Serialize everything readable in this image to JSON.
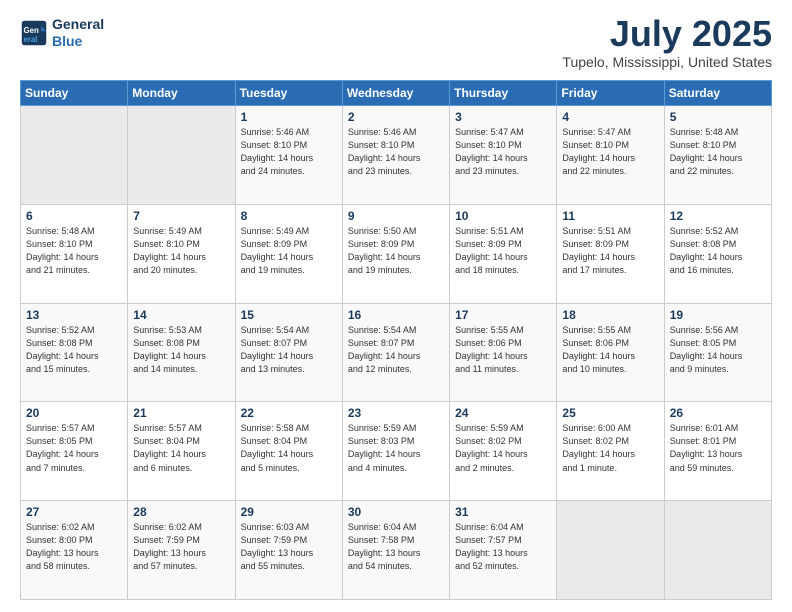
{
  "header": {
    "logo_line1": "General",
    "logo_line2": "Blue",
    "month": "July 2025",
    "location": "Tupelo, Mississippi, United States"
  },
  "days_of_week": [
    "Sunday",
    "Monday",
    "Tuesday",
    "Wednesday",
    "Thursday",
    "Friday",
    "Saturday"
  ],
  "weeks": [
    [
      {
        "day": "",
        "info": ""
      },
      {
        "day": "",
        "info": ""
      },
      {
        "day": "1",
        "info": "Sunrise: 5:46 AM\nSunset: 8:10 PM\nDaylight: 14 hours\nand 24 minutes."
      },
      {
        "day": "2",
        "info": "Sunrise: 5:46 AM\nSunset: 8:10 PM\nDaylight: 14 hours\nand 23 minutes."
      },
      {
        "day": "3",
        "info": "Sunrise: 5:47 AM\nSunset: 8:10 PM\nDaylight: 14 hours\nand 23 minutes."
      },
      {
        "day": "4",
        "info": "Sunrise: 5:47 AM\nSunset: 8:10 PM\nDaylight: 14 hours\nand 22 minutes."
      },
      {
        "day": "5",
        "info": "Sunrise: 5:48 AM\nSunset: 8:10 PM\nDaylight: 14 hours\nand 22 minutes."
      }
    ],
    [
      {
        "day": "6",
        "info": "Sunrise: 5:48 AM\nSunset: 8:10 PM\nDaylight: 14 hours\nand 21 minutes."
      },
      {
        "day": "7",
        "info": "Sunrise: 5:49 AM\nSunset: 8:10 PM\nDaylight: 14 hours\nand 20 minutes."
      },
      {
        "day": "8",
        "info": "Sunrise: 5:49 AM\nSunset: 8:09 PM\nDaylight: 14 hours\nand 19 minutes."
      },
      {
        "day": "9",
        "info": "Sunrise: 5:50 AM\nSunset: 8:09 PM\nDaylight: 14 hours\nand 19 minutes."
      },
      {
        "day": "10",
        "info": "Sunrise: 5:51 AM\nSunset: 8:09 PM\nDaylight: 14 hours\nand 18 minutes."
      },
      {
        "day": "11",
        "info": "Sunrise: 5:51 AM\nSunset: 8:09 PM\nDaylight: 14 hours\nand 17 minutes."
      },
      {
        "day": "12",
        "info": "Sunrise: 5:52 AM\nSunset: 8:08 PM\nDaylight: 14 hours\nand 16 minutes."
      }
    ],
    [
      {
        "day": "13",
        "info": "Sunrise: 5:52 AM\nSunset: 8:08 PM\nDaylight: 14 hours\nand 15 minutes."
      },
      {
        "day": "14",
        "info": "Sunrise: 5:53 AM\nSunset: 8:08 PM\nDaylight: 14 hours\nand 14 minutes."
      },
      {
        "day": "15",
        "info": "Sunrise: 5:54 AM\nSunset: 8:07 PM\nDaylight: 14 hours\nand 13 minutes."
      },
      {
        "day": "16",
        "info": "Sunrise: 5:54 AM\nSunset: 8:07 PM\nDaylight: 14 hours\nand 12 minutes."
      },
      {
        "day": "17",
        "info": "Sunrise: 5:55 AM\nSunset: 8:06 PM\nDaylight: 14 hours\nand 11 minutes."
      },
      {
        "day": "18",
        "info": "Sunrise: 5:55 AM\nSunset: 8:06 PM\nDaylight: 14 hours\nand 10 minutes."
      },
      {
        "day": "19",
        "info": "Sunrise: 5:56 AM\nSunset: 8:05 PM\nDaylight: 14 hours\nand 9 minutes."
      }
    ],
    [
      {
        "day": "20",
        "info": "Sunrise: 5:57 AM\nSunset: 8:05 PM\nDaylight: 14 hours\nand 7 minutes."
      },
      {
        "day": "21",
        "info": "Sunrise: 5:57 AM\nSunset: 8:04 PM\nDaylight: 14 hours\nand 6 minutes."
      },
      {
        "day": "22",
        "info": "Sunrise: 5:58 AM\nSunset: 8:04 PM\nDaylight: 14 hours\nand 5 minutes."
      },
      {
        "day": "23",
        "info": "Sunrise: 5:59 AM\nSunset: 8:03 PM\nDaylight: 14 hours\nand 4 minutes."
      },
      {
        "day": "24",
        "info": "Sunrise: 5:59 AM\nSunset: 8:02 PM\nDaylight: 14 hours\nand 2 minutes."
      },
      {
        "day": "25",
        "info": "Sunrise: 6:00 AM\nSunset: 8:02 PM\nDaylight: 14 hours\nand 1 minute."
      },
      {
        "day": "26",
        "info": "Sunrise: 6:01 AM\nSunset: 8:01 PM\nDaylight: 13 hours\nand 59 minutes."
      }
    ],
    [
      {
        "day": "27",
        "info": "Sunrise: 6:02 AM\nSunset: 8:00 PM\nDaylight: 13 hours\nand 58 minutes."
      },
      {
        "day": "28",
        "info": "Sunrise: 6:02 AM\nSunset: 7:59 PM\nDaylight: 13 hours\nand 57 minutes."
      },
      {
        "day": "29",
        "info": "Sunrise: 6:03 AM\nSunset: 7:59 PM\nDaylight: 13 hours\nand 55 minutes."
      },
      {
        "day": "30",
        "info": "Sunrise: 6:04 AM\nSunset: 7:58 PM\nDaylight: 13 hours\nand 54 minutes."
      },
      {
        "day": "31",
        "info": "Sunrise: 6:04 AM\nSunset: 7:57 PM\nDaylight: 13 hours\nand 52 minutes."
      },
      {
        "day": "",
        "info": ""
      },
      {
        "day": "",
        "info": ""
      }
    ]
  ]
}
